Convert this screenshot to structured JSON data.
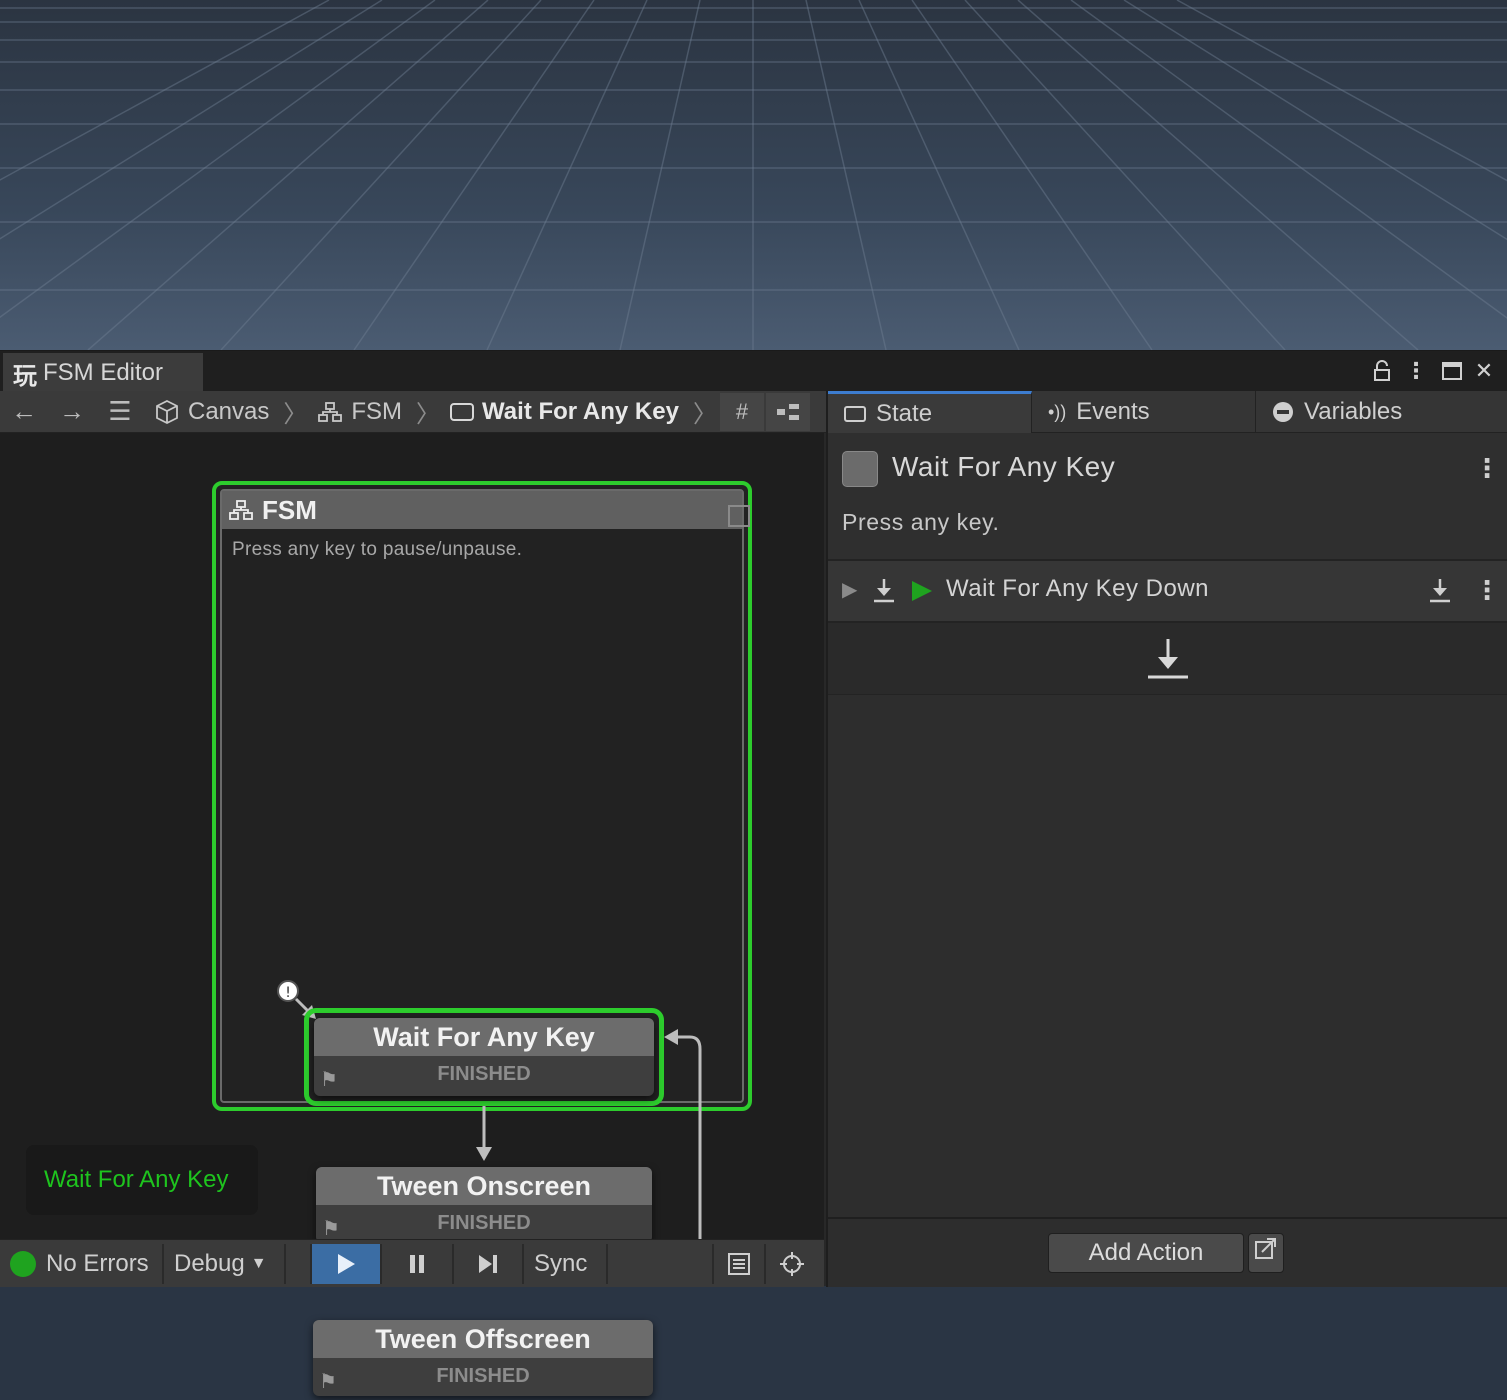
{
  "window": {
    "title": "FSM Editor"
  },
  "breadcrumb": {
    "items": [
      "Canvas",
      "FSM",
      "Wait For Any Key"
    ]
  },
  "graph": {
    "fsm_title": "FSM",
    "fsm_description": "Press any key to pause/unpause.",
    "states": [
      {
        "name": "Wait For Any Key",
        "event": "FINISHED"
      },
      {
        "name": "Tween Onscreen",
        "event": "FINISHED"
      },
      {
        "name": "Tween Offscreen",
        "event": "FINISHED"
      }
    ],
    "active_state_badge": "Wait For Any Key"
  },
  "statusbar": {
    "errors": "No Errors",
    "debug": "Debug",
    "sync": "Sync"
  },
  "inspector": {
    "tabs": [
      "State",
      "Events",
      "Variables"
    ],
    "state_name": "Wait For Any Key",
    "state_description": "Press any key.",
    "actions": [
      {
        "label": "Wait For Any Key Down"
      }
    ],
    "add_action_label": "Add Action"
  },
  "colors": {
    "selection_green": "#2dcc2d",
    "active_green": "#1ec41e",
    "play_blue": "#3b6da4"
  }
}
